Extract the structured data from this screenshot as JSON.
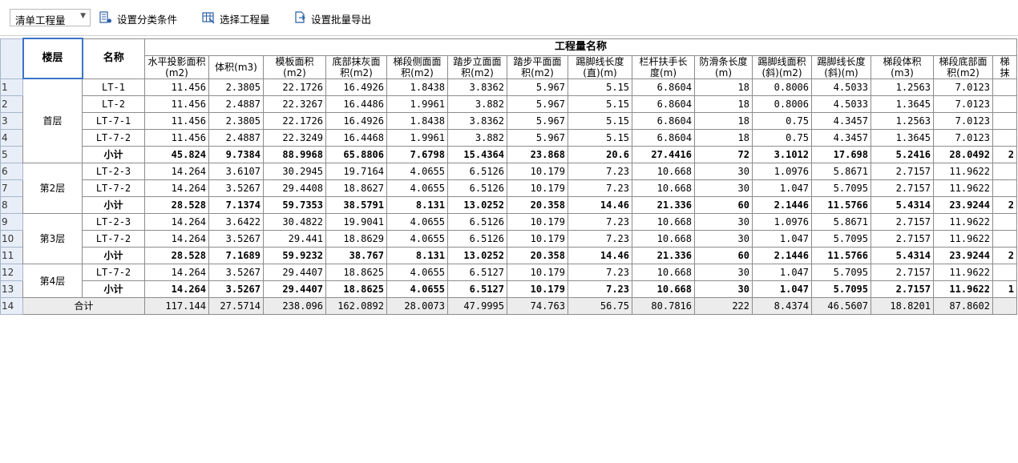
{
  "toolbar": {
    "select_value": "清单工程量",
    "buttons": [
      {
        "label": "设置分类条件",
        "icon": "filter-conditions-icon"
      },
      {
        "label": "选择工程量",
        "icon": "grid-select-icon"
      },
      {
        "label": "设置批量导出",
        "icon": "batch-export-icon"
      }
    ]
  },
  "table": {
    "group_header": "工程量名称",
    "floor_header": "楼层",
    "name_header": "名称",
    "columns": [
      "水平投影面积(m2)",
      "体积(m3)",
      "模板面积(m2)",
      "底部抹灰面积(m2)",
      "梯段侧面面积(m2)",
      "踏步立面面积(m2)",
      "踏步平面面积(m2)",
      "踢脚线长度(直)(m)",
      "栏杆扶手长度(m)",
      "防滑条长度(m)",
      "踢脚线面积(斜)(m2)",
      "踢脚线长度(斜)(m)",
      "梯段体积(m3)",
      "梯段底部面积(m2)",
      "梯抹"
    ],
    "row_numbers": [
      "1",
      "2",
      "3",
      "4",
      "5",
      "6",
      "7",
      "8",
      "9",
      "10",
      "11",
      "12",
      "13",
      "14"
    ],
    "floors": [
      "首层",
      "第2层",
      "第3层",
      "第4层"
    ],
    "rows": [
      {
        "name": "LT-1",
        "values": [
          "11.456",
          "2.3805",
          "22.1726",
          "16.4926",
          "1.8438",
          "3.8362",
          "5.967",
          "5.15",
          "6.8604",
          "18",
          "0.8006",
          "4.5033",
          "1.2563",
          "7.0123",
          ""
        ]
      },
      {
        "name": "LT-2",
        "values": [
          "11.456",
          "2.4887",
          "22.3267",
          "16.4486",
          "1.9961",
          "3.882",
          "5.967",
          "5.15",
          "6.8604",
          "18",
          "0.8006",
          "4.5033",
          "1.3645",
          "7.0123",
          ""
        ]
      },
      {
        "name": "LT-7-1",
        "values": [
          "11.456",
          "2.3805",
          "22.1726",
          "16.4926",
          "1.8438",
          "3.8362",
          "5.967",
          "5.15",
          "6.8604",
          "18",
          "0.75",
          "4.3457",
          "1.2563",
          "7.0123",
          ""
        ]
      },
      {
        "name": "LT-7-2",
        "values": [
          "11.456",
          "2.4887",
          "22.3249",
          "16.4468",
          "1.9961",
          "3.882",
          "5.967",
          "5.15",
          "6.8604",
          "18",
          "0.75",
          "4.3457",
          "1.3645",
          "7.0123",
          ""
        ]
      },
      {
        "name": "小计",
        "values": [
          "45.824",
          "9.7384",
          "88.9968",
          "65.8806",
          "7.6798",
          "15.4364",
          "23.868",
          "20.6",
          "27.4416",
          "72",
          "3.1012",
          "17.698",
          "5.2416",
          "28.0492",
          "2"
        ]
      },
      {
        "name": "LT-2-3",
        "values": [
          "14.264",
          "3.6107",
          "30.2945",
          "19.7164",
          "4.0655",
          "6.5126",
          "10.179",
          "7.23",
          "10.668",
          "30",
          "1.0976",
          "5.8671",
          "2.7157",
          "11.9622",
          ""
        ]
      },
      {
        "name": "LT-7-2",
        "values": [
          "14.264",
          "3.5267",
          "29.4408",
          "18.8627",
          "4.0655",
          "6.5126",
          "10.179",
          "7.23",
          "10.668",
          "30",
          "1.047",
          "5.7095",
          "2.7157",
          "11.9622",
          ""
        ]
      },
      {
        "name": "小计",
        "values": [
          "28.528",
          "7.1374",
          "59.7353",
          "38.5791",
          "8.131",
          "13.0252",
          "20.358",
          "14.46",
          "21.336",
          "60",
          "2.1446",
          "11.5766",
          "5.4314",
          "23.9244",
          "2"
        ]
      },
      {
        "name": "LT-2-3",
        "values": [
          "14.264",
          "3.6422",
          "30.4822",
          "19.9041",
          "4.0655",
          "6.5126",
          "10.179",
          "7.23",
          "10.668",
          "30",
          "1.0976",
          "5.8671",
          "2.7157",
          "11.9622",
          ""
        ]
      },
      {
        "name": "LT-7-2",
        "values": [
          "14.264",
          "3.5267",
          "29.441",
          "18.8629",
          "4.0655",
          "6.5126",
          "10.179",
          "7.23",
          "10.668",
          "30",
          "1.047",
          "5.7095",
          "2.7157",
          "11.9622",
          ""
        ]
      },
      {
        "name": "小计",
        "values": [
          "28.528",
          "7.1689",
          "59.9232",
          "38.767",
          "8.131",
          "13.0252",
          "20.358",
          "14.46",
          "21.336",
          "60",
          "2.1446",
          "11.5766",
          "5.4314",
          "23.9244",
          "2"
        ]
      },
      {
        "name": "LT-7-2",
        "values": [
          "14.264",
          "3.5267",
          "29.4407",
          "18.8625",
          "4.0655",
          "6.5127",
          "10.179",
          "7.23",
          "10.668",
          "30",
          "1.047",
          "5.7095",
          "2.7157",
          "11.9622",
          ""
        ]
      },
      {
        "name": "小计",
        "values": [
          "14.264",
          "3.5267",
          "29.4407",
          "18.8625",
          "4.0655",
          "6.5127",
          "10.179",
          "7.23",
          "10.668",
          "30",
          "1.047",
          "5.7095",
          "2.7157",
          "11.9622",
          "1"
        ]
      }
    ],
    "total": {
      "label": "合计",
      "values": [
        "117.144",
        "27.5714",
        "238.096",
        "162.0892",
        "28.0073",
        "47.9995",
        "74.763",
        "56.75",
        "80.7816",
        "222",
        "8.4374",
        "46.5607",
        "18.8201",
        "87.8602",
        ""
      ]
    }
  }
}
